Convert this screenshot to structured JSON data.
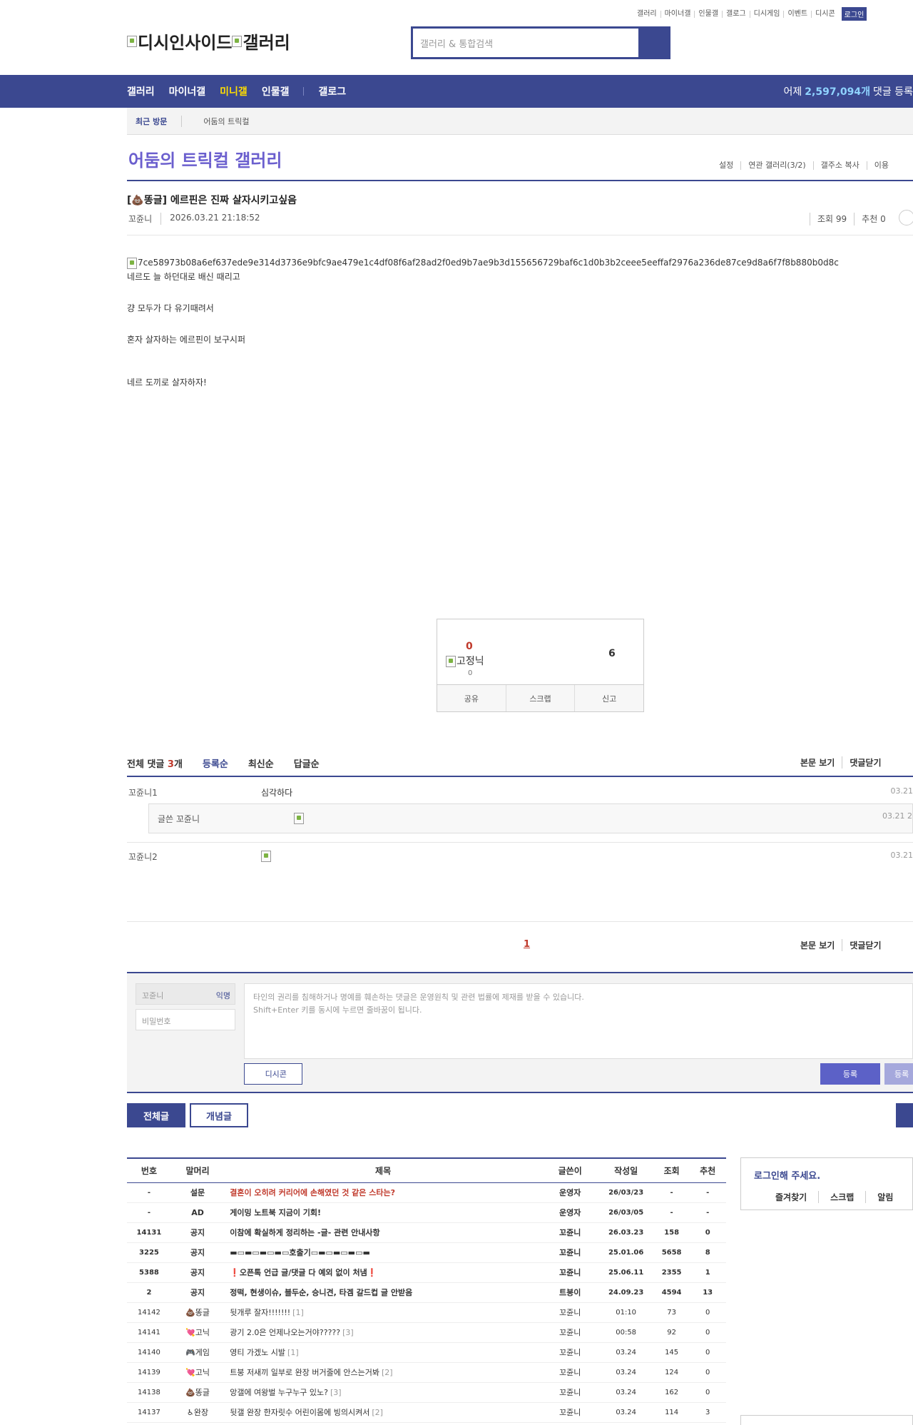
{
  "util_links": [
    "갤러리",
    "마이너갤",
    "인물갤",
    "갤로그",
    "디시게임",
    "이벤트",
    "디시콘"
  ],
  "login_btn": "로그인",
  "logo": {
    "part1": "디시인사이드",
    "part2": "갤러리"
  },
  "search": {
    "placeholder": "갤러리 & 통합검색"
  },
  "gnb": {
    "items": [
      "갤러리",
      "마이너갤",
      "미니갤",
      "인물갤"
    ],
    "active_index": 2,
    "gallog": "갤로그",
    "yesterday_prefix": "어제",
    "yesterday_count": "2,597,094개",
    "yesterday_suffix": "댓글 등록"
  },
  "recent": {
    "title": "최근 방문",
    "item": "어둠의 트릭컬"
  },
  "gallery": {
    "title": "어둠의 트릭컬 갤러리",
    "options": [
      "설정",
      "연관 갤러리(3/2)",
      "갤주소 복사",
      "이용"
    ]
  },
  "post": {
    "title": "[💩똥글] 에르핀은 진짜 살자시키고싶음",
    "author": "꼬쥰니",
    "date": "2026.03.21 21:18:52",
    "views": "조회 99",
    "recommend": "추천 0",
    "image_alt": "7ce58973b08a6ef637ede9e314d3736e9bfc9ae479e1c4df08f6af28ad2f0ed9b7ae9b3d155656729baf6c1d0b3b2ceee5eeffaf2976a236de87ce9d8a6f7f8b880b0d8c",
    "lines": [
      "네르도 늘 하던대로 배신 때리고",
      "걍 모두가 다 유기때려서",
      "혼자 살자하는 에르핀이 보구시퍼",
      "네르 도끼로 살자하자!"
    ]
  },
  "vote": {
    "up": "0",
    "fix_label": "고정닉",
    "fix_count": "0",
    "down": "6",
    "actions": [
      "공유",
      "스크랩",
      "신고"
    ]
  },
  "comments": {
    "total_label": "전체 댓글",
    "total_count": "3",
    "total_unit": "개",
    "sorts": [
      "등록순",
      "최신순",
      "답글순"
    ],
    "view_opts": [
      "본문 보기",
      "댓글닫기"
    ],
    "items": [
      {
        "nick": "꼬쥰니1",
        "text": "심각하다",
        "date": "03.21"
      },
      {
        "nick": "글쓴 꼬쥰니",
        "text": "",
        "date": "03.21 2"
      },
      {
        "nick": "꼬쥰니2",
        "text": "",
        "date": "03.21"
      }
    ],
    "page": "1"
  },
  "comment_form": {
    "nick": "꼬쥰니",
    "anon": "익명",
    "pw_placeholder": "비밀번호",
    "ta_line1": "타인의 권리를 침해하거나 명예를 훼손하는 댓글은 운영원칙 및 관련 법률에 제재를 받을 수 있습니다.",
    "ta_line2": "Shift+Enter 키를 동시에 누르면 줄바꿈이 됩니다.",
    "dccon": "디시콘",
    "submit": "등록",
    "submit2": "등록"
  },
  "list_tabs": [
    "전체글",
    "개념글"
  ],
  "list": {
    "headers": [
      "번호",
      "말머리",
      "제목",
      "글쓴이",
      "작성일",
      "조회",
      "추천"
    ],
    "rows": [
      {
        "no": "-",
        "head": "설문",
        "title": "결혼이 오히려 커리어에 손해였던 것 같은 스타는?",
        "reply": "",
        "writer": "운영자",
        "date": "26/03/23",
        "views": "-",
        "rec": "-",
        "notice": true,
        "red": true
      },
      {
        "no": "-",
        "head": "AD",
        "title": "게이밍 노트북 지금이 기회!",
        "reply": "",
        "writer": "운영자",
        "date": "26/03/05",
        "views": "-",
        "rec": "-",
        "notice": true,
        "red": false
      },
      {
        "no": "14131",
        "head": "공지",
        "title": "이참에 확실하게 정리하는 -글- 관련 안내사항",
        "reply": "",
        "writer": "꼬쥰니",
        "date": "26.03.23",
        "views": "158",
        "rec": "0",
        "notice": true,
        "red": false
      },
      {
        "no": "3225",
        "head": "공지",
        "title": "▬▭▬▭▬▭▬▭호출기▭▬▭▬▭▬▭▬",
        "reply": "",
        "writer": "꼬쥰니",
        "date": "25.01.06",
        "views": "5658",
        "rec": "8",
        "notice": true,
        "red": false
      },
      {
        "no": "5388",
        "head": "공지",
        "title": "❗오픈톡 언급 글/댓글 다 예외 없이 처냄❗",
        "reply": "",
        "writer": "꼬쥰니",
        "date": "25.06.11",
        "views": "2355",
        "rec": "1",
        "notice": true,
        "red": false
      },
      {
        "no": "2",
        "head": "공지",
        "title": "정떡, 현생이슈, 블두순, 승니견, 타겜 갈드컵 글 안받음",
        "reply": "",
        "writer": "트붕이",
        "date": "24.09.23",
        "views": "4594",
        "rec": "13",
        "notice": true,
        "red": false
      },
      {
        "no": "14142",
        "head": "💩똥글",
        "title": "뒷개루 잘자!!!!!!!",
        "reply": "[1]",
        "writer": "꼬쥰니",
        "date": "01:10",
        "views": "73",
        "rec": "0",
        "notice": false,
        "red": false
      },
      {
        "no": "14141",
        "head": "💘고닉",
        "title": "광기 2.0은 언제나오는거야?????",
        "reply": "[3]",
        "writer": "꼬쥰니",
        "date": "00:58",
        "views": "92",
        "rec": "0",
        "notice": false,
        "red": false
      },
      {
        "no": "14140",
        "head": "🎮게임",
        "title": "영티 가겠노 시발",
        "reply": "[1]",
        "writer": "꼬쥰니",
        "date": "03.24",
        "views": "145",
        "rec": "0",
        "notice": false,
        "red": false
      },
      {
        "no": "14139",
        "head": "💘고닉",
        "title": "트붕 저새끼 일부로 완장 버거줄에 안스는거봐",
        "reply": "[2]",
        "writer": "꼬쥰니",
        "date": "03.24",
        "views": "124",
        "rec": "0",
        "notice": false,
        "red": false
      },
      {
        "no": "14138",
        "head": "💩똥글",
        "title": "앙갤에 여왕벌 누구누구 있노?",
        "reply": "[3]",
        "writer": "꼬쥰니",
        "date": "03.24",
        "views": "162",
        "rec": "0",
        "notice": false,
        "red": false
      },
      {
        "no": "14137",
        "head": "♿완장",
        "title": "뒷갤 완장 한자릿수 어린이몸에 빙의시켜서",
        "reply": "[2]",
        "writer": "꼬쥰니",
        "date": "03.24",
        "views": "114",
        "rec": "3",
        "notice": false,
        "red": false
      }
    ]
  },
  "login_box": {
    "title": "로그인해 주세요.",
    "actions": [
      "즐겨찾기",
      "스크랩",
      "알림"
    ]
  },
  "colors": {
    "brand": "#3b4890",
    "accent": "#6b5fce",
    "red": "#c0392b"
  }
}
